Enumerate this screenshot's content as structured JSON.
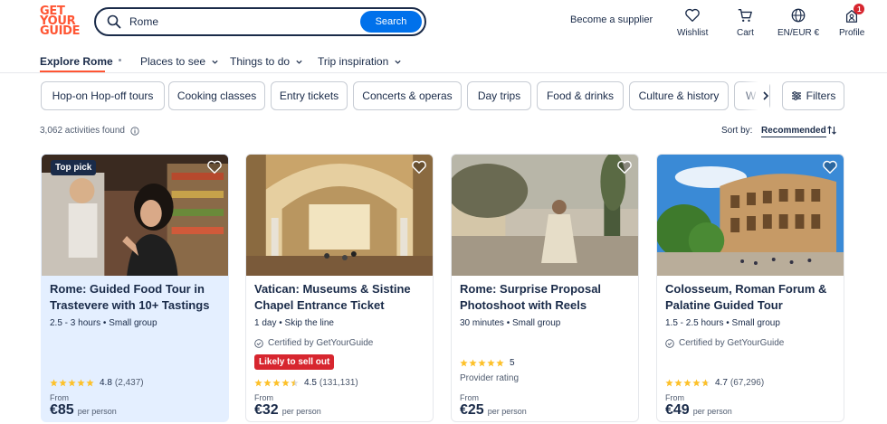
{
  "brand": {
    "logo_lines": [
      "GET",
      "YOUR",
      "GUIDE"
    ],
    "accent": "#ff5533",
    "primary": "#0071eb",
    "dark": "#1a2b49",
    "alert": "#d7262f"
  },
  "search": {
    "value": "Rome",
    "button_label": "Search",
    "icon": "search-icon"
  },
  "header": {
    "supplier_link": "Become a supplier",
    "wishlist_label": "Wishlist",
    "cart_label": "Cart",
    "currency_label": "EN/EUR €",
    "profile_label": "Profile",
    "profile_badge": "1"
  },
  "subnav": {
    "items": [
      {
        "label": "Explore Rome",
        "active": true
      },
      {
        "label": "Places to see"
      },
      {
        "label": "Things to do"
      },
      {
        "label": "Trip inspiration"
      }
    ]
  },
  "categories": [
    "Hop-on Hop-off tours",
    "Cooking classes",
    "Entry tickets",
    "Concerts & operas",
    "Day trips",
    "Food & drinks",
    "Culture & history",
    "W"
  ],
  "filters_label": "Filters",
  "results": {
    "count_text": "3,062 activities found",
    "sort_label": "Sort by:",
    "sort_value": "Recommended"
  },
  "cards": [
    {
      "badge": "Top pick",
      "title": "Rome: Guided Food Tour in Trastevere with 10+ Tastings",
      "meta": "2.5 - 3 hours • Small group",
      "rating": "4.8",
      "review_count": "(2,437)",
      "from_label": "From",
      "price": "€85",
      "per_label": "per person"
    },
    {
      "title": "Vatican: Museums & Sistine Chapel Entrance Ticket",
      "meta": "1 day • Skip the line",
      "certified": "Certified by GetYourGuide",
      "sellout": "Likely to sell out",
      "rating": "4.5",
      "review_count": "(131,131)",
      "from_label": "From",
      "price": "€32",
      "per_label": "per person"
    },
    {
      "title": "Rome: Surprise Proposal Photoshoot with Reels",
      "meta": "30 minutes • Small group",
      "rating": "5",
      "provider": "Provider rating",
      "from_label": "From",
      "price": "€25",
      "per_label": "per person"
    },
    {
      "title": "Colosseum, Roman Forum & Palatine Guided Tour",
      "meta": "1.5 - 2.5 hours • Small group",
      "certified": "Certified by GetYourGuide",
      "rating": "4.7",
      "review_count": "(67,296)",
      "from_label": "From",
      "price": "€49",
      "per_label": "per person"
    }
  ]
}
